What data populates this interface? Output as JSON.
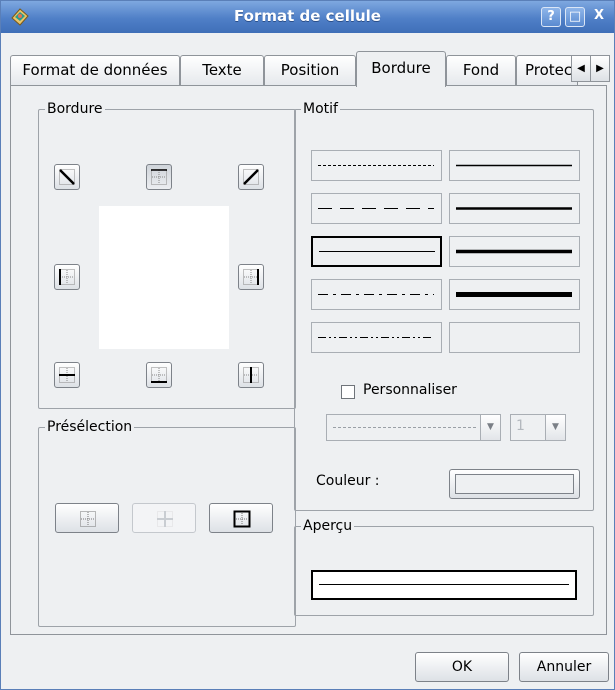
{
  "window": {
    "title": "Format de cellule",
    "help": "?",
    "maximize": "□",
    "close": "X"
  },
  "tabs": [
    {
      "label": "Format de données"
    },
    {
      "label": "Texte"
    },
    {
      "label": "Position"
    },
    {
      "label": "Bordure"
    },
    {
      "label": "Fond"
    },
    {
      "label": "Protec"
    }
  ],
  "active_tab": "Bordure",
  "border_group": {
    "label": "Bordure"
  },
  "motif_group": {
    "label": "Motif",
    "customize_label": "Personnaliser",
    "customize_checked": false,
    "custom_style_value": "",
    "custom_width_value": "1",
    "color_label": "Couleur :"
  },
  "preset_group": {
    "label": "Présélection"
  },
  "preview_group": {
    "label": "Aperçu"
  },
  "buttons": {
    "ok": "OK",
    "cancel": "Annuler"
  }
}
